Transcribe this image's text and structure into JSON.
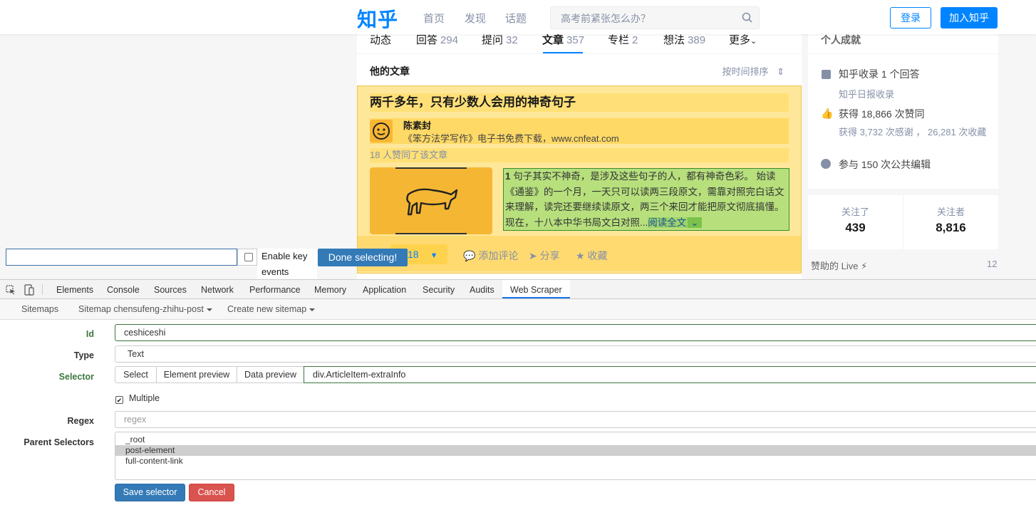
{
  "zhihu": {
    "logo": "知乎",
    "nav": [
      "首页",
      "发现",
      "话题"
    ],
    "search_placeholder": "高考前紧张怎么办？",
    "login": "登录",
    "join": "加入知乎",
    "tabs": [
      {
        "label": "动态",
        "count": ""
      },
      {
        "label": "回答",
        "count": "294"
      },
      {
        "label": "提问",
        "count": "32"
      },
      {
        "label": "文章",
        "count": "357"
      },
      {
        "label": "专栏",
        "count": "2"
      },
      {
        "label": "想法",
        "count": "389"
      },
      {
        "label": "更多",
        "count": ""
      }
    ],
    "section_title": "他的文章",
    "sort_label": "按时间排序",
    "article": {
      "title": "两千多年，只有少数人会用的神奇句子",
      "author": "陈素封",
      "author_bio": "《笨方法学写作》电子书免费下载，www.cnfeat.com",
      "votes_text": "18 人赞同了该文章",
      "excerpt_num": "1",
      "excerpt": " 句子其实不神奇，是涉及这些句子的人，都有神奇色彩。 始读《通鉴》的一个月，一天只可以读两三段原文，需靠对照完白话文来理解，读完还要继续读原文，两三个来回才能把原文彻底搞懂。现在，十八本中华书局文白对照...",
      "read_more": "阅读全文",
      "vote_count": "18",
      "comment": "添加评论",
      "share": "分享",
      "collect": "收藏"
    },
    "side": {
      "achievements_title": "个人成就",
      "collect": "知乎收录 1 个回答",
      "collect_sub": "知乎日报收录",
      "likes": "获得 18,866 次赞同",
      "thanks": "获得 3,732 次感谢 ， 26,281 次收藏",
      "edits": "参与 150 次公共编辑",
      "following_label": "关注了",
      "following": "439",
      "followers_label": "关注者",
      "followers": "8,816",
      "live_label": "赞助的 Live ⚡",
      "live_count": "12"
    }
  },
  "selector_bar": {
    "input_value": "",
    "enable_key": "Enable key events",
    "done": "Done selecting!"
  },
  "devtools": {
    "tabs": [
      "Elements",
      "Console",
      "Sources",
      "Network",
      "Performance",
      "Memory",
      "Application",
      "Security",
      "Audits",
      "Web Scraper"
    ],
    "active_tab": "Web Scraper"
  },
  "webscraper": {
    "menu": {
      "sitemaps": "Sitemaps",
      "sitemap": "Sitemap chensufeng-zhihu-post",
      "create": "Create new sitemap"
    },
    "form": {
      "id_label": "Id",
      "id_value": "ceshiceshi",
      "type_label": "Type",
      "type_value": "Text",
      "selector_label": "Selector",
      "select_btn": "Select",
      "element_preview": "Element preview",
      "data_preview": "Data preview",
      "selector_value": "div.ArticleItem-extraInfo",
      "multiple_label": "Multiple",
      "multiple_checked": true,
      "regex_label": "Regex",
      "regex_placeholder": "regex",
      "parent_label": "Parent Selectors",
      "parents": [
        "_root",
        "post-element",
        "full-content-link"
      ],
      "parent_selected": "post-element",
      "save": "Save selector",
      "cancel": "Cancel"
    }
  }
}
